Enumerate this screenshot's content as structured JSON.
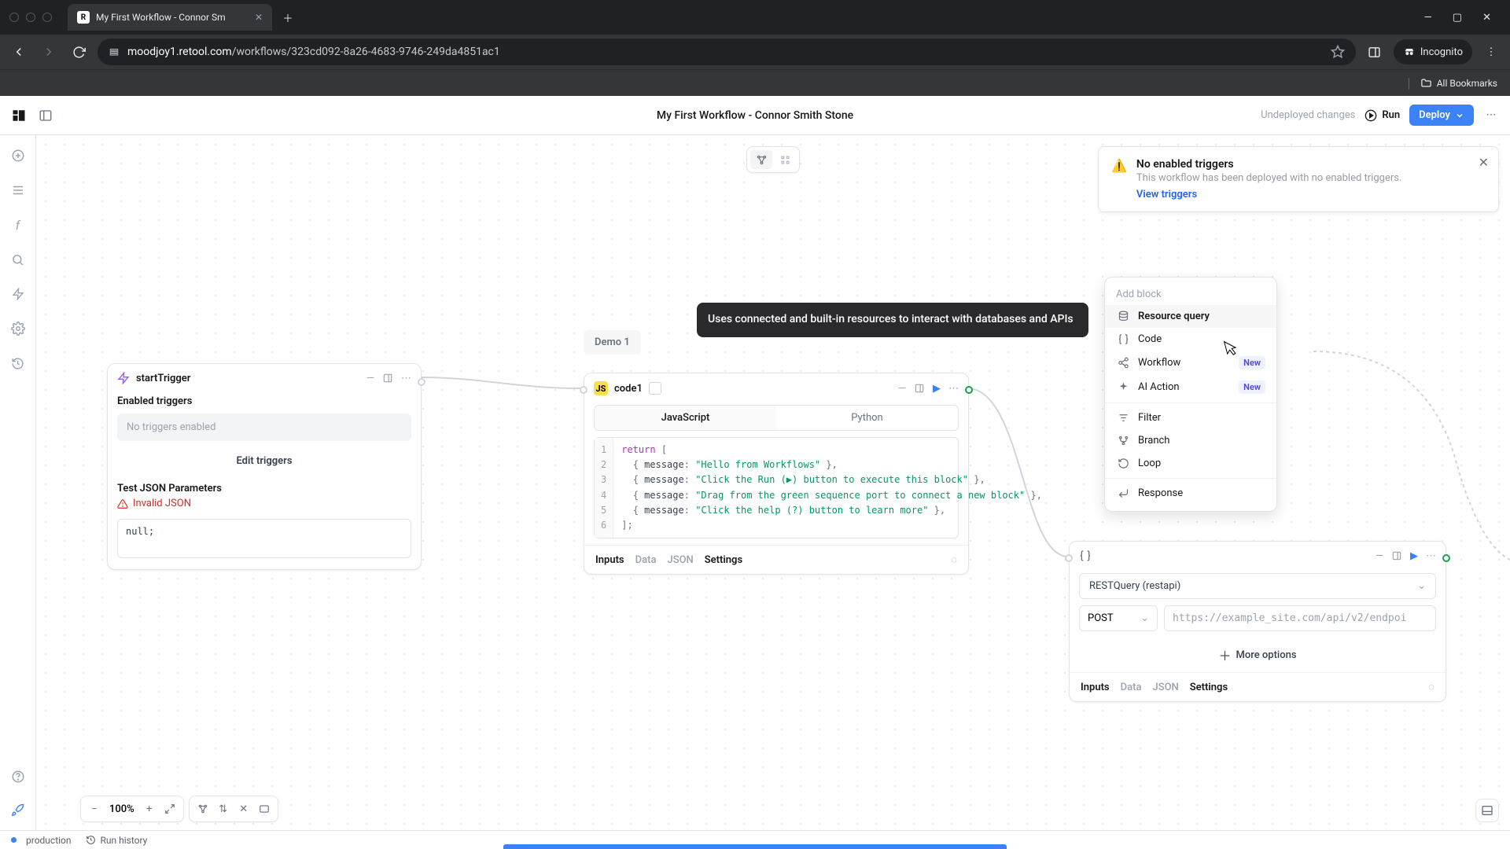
{
  "browser": {
    "tab_title": "My First Workflow - Connor Sm",
    "url_host": "moodjoy1.retool.com",
    "url_path": "/workflows/323cd092-8a26-4683-9746-249da4851ac1",
    "incognito": "Incognito",
    "all_bookmarks": "All Bookmarks"
  },
  "header": {
    "title": "My First Workflow - Connor Smith Stone",
    "undeployed": "Undeployed changes",
    "run": "Run",
    "deploy": "Deploy"
  },
  "notif": {
    "title": "No enabled triggers",
    "sub": "This workflow has been deployed with no enabled triggers.",
    "link": "View triggers"
  },
  "demo_label": "Demo 1",
  "start_node": {
    "title": "startTrigger",
    "enabled_label": "Enabled triggers",
    "none_text": "No triggers enabled",
    "edit": "Edit triggers",
    "test_label": "Test JSON Parameters",
    "invalid": "Invalid JSON",
    "code": "null;"
  },
  "code_node": {
    "title": "code1",
    "tab_js": "JavaScript",
    "tab_py": "Python",
    "gutter": [
      "1",
      "2",
      "3",
      "4",
      "5",
      "6"
    ],
    "kw_return": "return",
    "msg_key": "message",
    "str1": "\"Hello from Workflows\"",
    "str2": "\"Click the Run (▶) button to execute this block\"",
    "str3": "\"Drag from the green sequence port to connect a new block\"",
    "str4": "\"Click the help (?) button to learn more\"",
    "footer": {
      "inputs": "Inputs",
      "data": "Data",
      "json": "JSON",
      "settings": "Settings"
    }
  },
  "tooltip": "Uses connected and built-in resources to interact with databases and APIs",
  "menu": {
    "title": "Add block",
    "resource": "Resource query",
    "code": "Code",
    "workflow": "Workflow",
    "ai": "AI Action",
    "filter": "Filter",
    "branch": "Branch",
    "loop": "Loop",
    "response": "Response",
    "new": "New"
  },
  "query_node": {
    "resource": "RESTQuery (restapi)",
    "method": "POST",
    "url_ph": "https://example_site.com/api/v2/endpoi",
    "more": "More options",
    "footer": {
      "inputs": "Inputs",
      "data": "Data",
      "json": "JSON",
      "settings": "Settings"
    }
  },
  "zoom": "100%",
  "status": {
    "env": "production",
    "run_history": "Run history"
  }
}
